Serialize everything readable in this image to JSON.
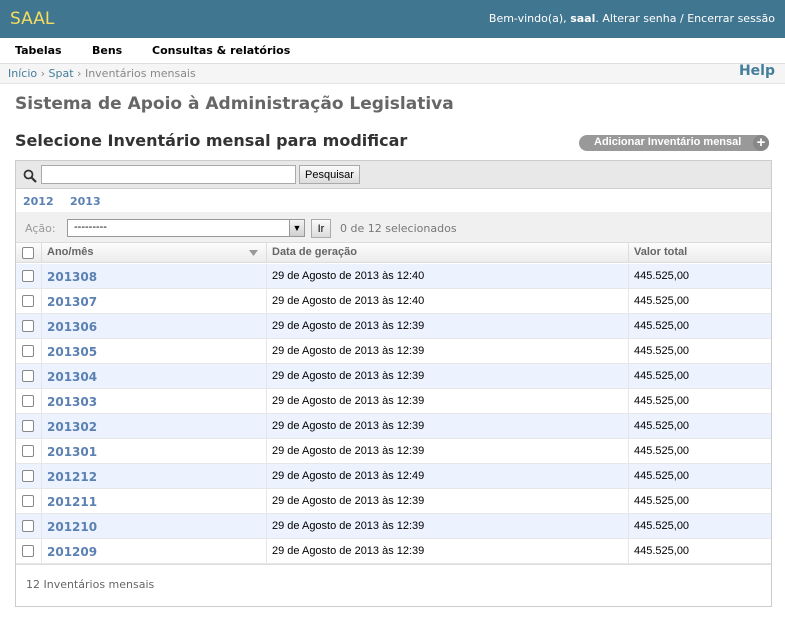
{
  "header": {
    "brand": "SAAL",
    "welcome": "Bem-vindo(a),",
    "username": "saal",
    "change_password": "Alterar senha",
    "separator": "/",
    "logout": "Encerrar sessão"
  },
  "nav": {
    "items": [
      "Tabelas",
      "Bens",
      "Consultas & relatórios"
    ]
  },
  "breadcrumbs": {
    "home": "Início",
    "app": "Spat",
    "current": "Inventários mensais",
    "sep": "›",
    "help": "Help"
  },
  "site_title": "Sistema de Apoio à Administração Legislativa",
  "page_title": "Selecione Inventário mensal para modificar",
  "add_button": {
    "label": "Adicionar Inventário mensal",
    "icon": "plus-icon"
  },
  "search": {
    "value": "",
    "button": "Pesquisar",
    "icon": "magnifier-icon"
  },
  "date_hierarchy": [
    "2012",
    "2013"
  ],
  "actions": {
    "label": "Ação:",
    "selected": "---------",
    "go": "Ir",
    "counter": "0 de 12 selecionados"
  },
  "table": {
    "columns": [
      "Ano/mês",
      "Data de geração",
      "Valor total"
    ],
    "rows": [
      {
        "ano_mes": "201308",
        "data": "29 de Agosto de 2013 às 12:40",
        "valor": "445.525,00"
      },
      {
        "ano_mes": "201307",
        "data": "29 de Agosto de 2013 às 12:40",
        "valor": "445.525,00"
      },
      {
        "ano_mes": "201306",
        "data": "29 de Agosto de 2013 às 12:39",
        "valor": "445.525,00"
      },
      {
        "ano_mes": "201305",
        "data": "29 de Agosto de 2013 às 12:39",
        "valor": "445.525,00"
      },
      {
        "ano_mes": "201304",
        "data": "29 de Agosto de 2013 às 12:39",
        "valor": "445.525,00"
      },
      {
        "ano_mes": "201303",
        "data": "29 de Agosto de 2013 às 12:39",
        "valor": "445.525,00"
      },
      {
        "ano_mes": "201302",
        "data": "29 de Agosto de 2013 às 12:39",
        "valor": "445.525,00"
      },
      {
        "ano_mes": "201301",
        "data": "29 de Agosto de 2013 às 12:39",
        "valor": "445.525,00"
      },
      {
        "ano_mes": "201212",
        "data": "29 de Agosto de 2013 às 12:49",
        "valor": "445.525,00"
      },
      {
        "ano_mes": "201211",
        "data": "29 de Agosto de 2013 às 12:39",
        "valor": "445.525,00"
      },
      {
        "ano_mes": "201210",
        "data": "29 de Agosto de 2013 às 12:39",
        "valor": "445.525,00"
      },
      {
        "ano_mes": "201209",
        "data": "29 de Agosto de 2013 às 12:39",
        "valor": "445.525,00"
      }
    ]
  },
  "paginator": "12 Inventários mensais",
  "colors": {
    "header_bg": "#417690",
    "brand": "#f5dd5d",
    "link": "#5b80b2",
    "row_alt": "#edf3fe"
  }
}
